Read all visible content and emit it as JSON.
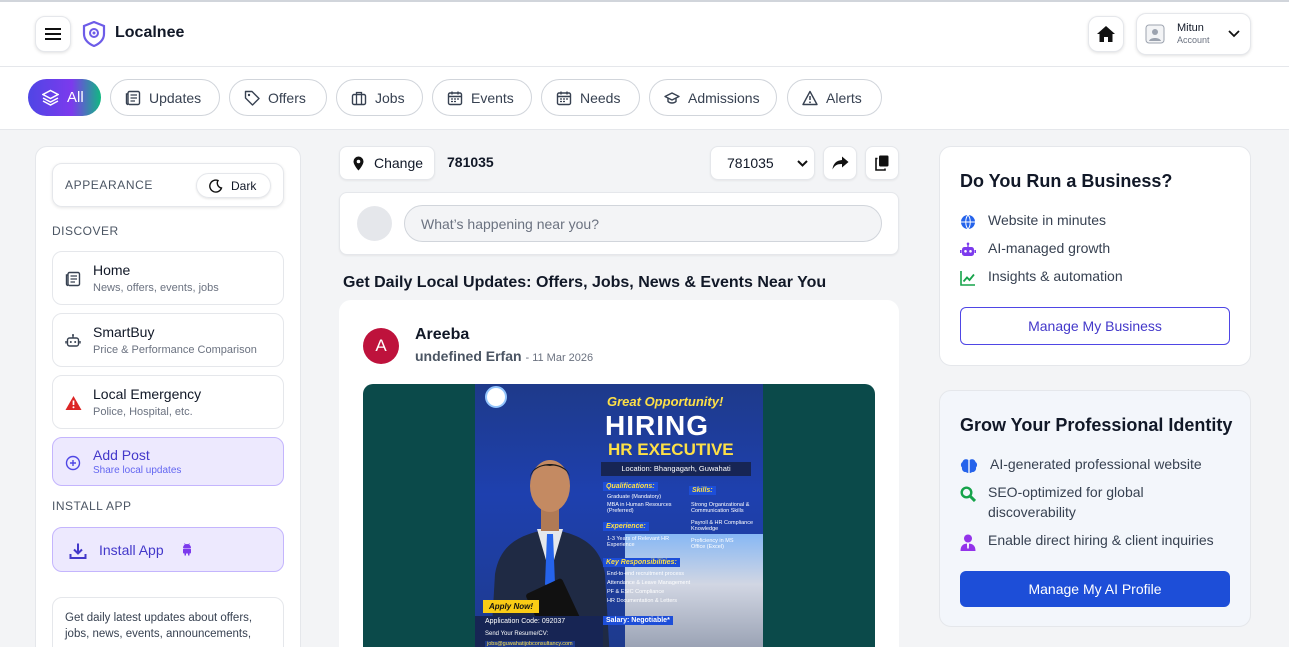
{
  "app": {
    "name": "Localnee"
  },
  "header": {
    "account_name": "Mitun",
    "account_sub": "Account"
  },
  "categories": [
    {
      "label": "All",
      "icon": "layers-icon",
      "active": true
    },
    {
      "label": "Updates",
      "icon": "newspaper-icon"
    },
    {
      "label": "Offers",
      "icon": "tag-icon"
    },
    {
      "label": "Jobs",
      "icon": "briefcase-icon"
    },
    {
      "label": "Events",
      "icon": "calendar-icon"
    },
    {
      "label": "Needs",
      "icon": "calendar-icon"
    },
    {
      "label": "Admissions",
      "icon": "graduation-cap-icon"
    },
    {
      "label": "Alerts",
      "icon": "warning-icon"
    }
  ],
  "sidebar": {
    "appearance_label": "APPEARANCE",
    "theme_toggle": "Dark",
    "discover_label": "DISCOVER",
    "items": [
      {
        "title": "Home",
        "subtitle": "News, offers, events, jobs"
      },
      {
        "title": "SmartBuy",
        "subtitle": "Price & Performance Comparison"
      },
      {
        "title": "Local Emergency",
        "subtitle": "Police, Hospital, etc."
      },
      {
        "title": "Add Post",
        "subtitle": "Share local updates"
      }
    ],
    "install_label": "INSTALL APP",
    "install_button": "Install App",
    "about_text": "Get daily latest updates about offers, jobs, news, events, announcements,"
  },
  "location": {
    "change_label": "Change",
    "pincode": "781035",
    "select_value": "781035"
  },
  "composer": {
    "placeholder": "What’s happening near you?"
  },
  "feed": {
    "heading": "Get Daily Local Updates: Offers, Jobs, News & Events Near You"
  },
  "post": {
    "avatar_letter": "A",
    "author": "Areeba",
    "subline": "undefined Erfan",
    "date": "11 Mar 2026",
    "image": {
      "banner": "Great Opportunity!",
      "hiring": "HIRING",
      "role": "HR EXECUTIVE",
      "location": "Location: Bhangagarh, Guwahati",
      "qualifications_title": "Qualifications:",
      "qualifications": [
        "Graduate (Mandatory)",
        "MBA in Human Resources (Preferred)"
      ],
      "experience_title": "Experience:",
      "experience": "1-3 Years of Relevant HR Experience",
      "responsibilities_title": "Key Responsibilities:",
      "responsibilities": [
        "End-to-end recruitment process",
        "Attendance & Leave Management",
        "PF & ESIC Compliance",
        "HR Documentation & Letters"
      ],
      "skills_title": "Skills:",
      "skills": [
        "Strong Organizational & Communication Skills",
        "Payroll & HR Compliance Knowledge",
        "Proficiency in MS Office (Excel)"
      ],
      "apply": "Apply Now!",
      "salary": "Salary: Negotiable*",
      "app_code": "Application Code: 092037",
      "send": "Send Your Resume/CV:",
      "email": "jobs@guwahatijobconsultancy.com"
    }
  },
  "business": {
    "title": "Do You Run a Business?",
    "features": [
      "Website in minutes",
      "AI-managed growth",
      "Insights & automation"
    ],
    "button": "Manage My Business"
  },
  "identity": {
    "title": "Grow Your Professional Identity",
    "features": [
      "AI-generated professional website",
      "SEO-optimized for global discoverability",
      "Enable direct hiring & client inquiries"
    ],
    "button": "Manage My AI Profile"
  },
  "colors": {
    "accent": "#4f46e5",
    "primary_button": "#1d4ed8",
    "danger": "#dc2626",
    "poster_bg": "#0b4a4a"
  }
}
